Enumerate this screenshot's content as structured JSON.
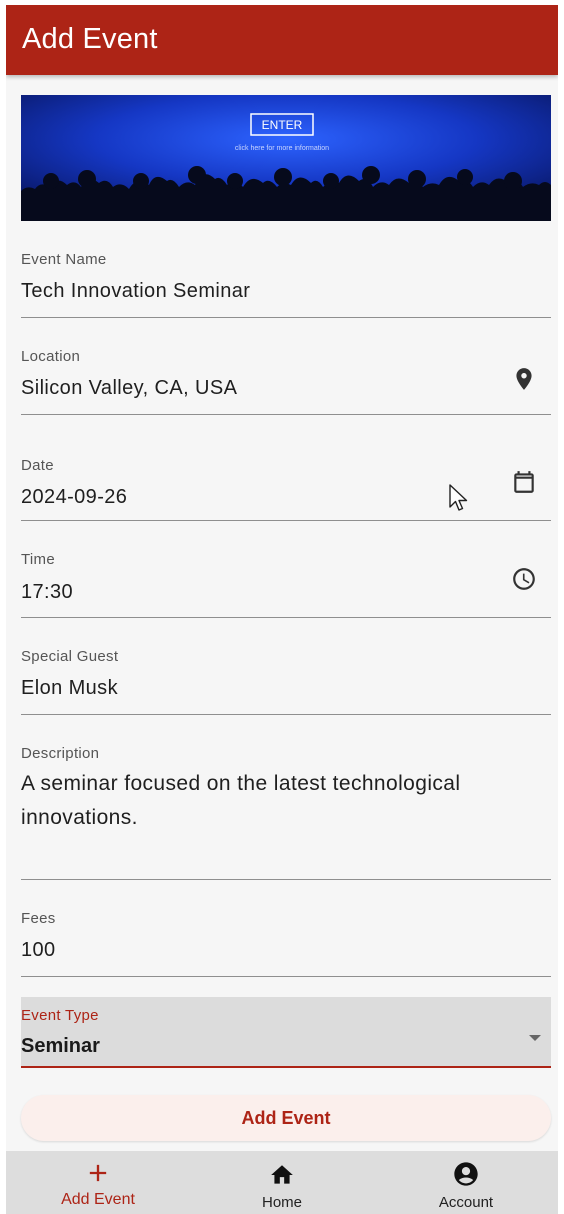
{
  "appbar": {
    "title": "Add Event"
  },
  "banner": {
    "button_label": "ENTER",
    "caption": "click here for more information"
  },
  "form": {
    "event_name": {
      "label": "Event Name",
      "value": "Tech Innovation Seminar"
    },
    "location": {
      "label": "Location",
      "value": "Silicon Valley, CA, USA",
      "icon": "location-pin-icon"
    },
    "date": {
      "label": "Date",
      "value": "2024-09-26",
      "icon": "calendar-icon"
    },
    "time": {
      "label": "Time",
      "value": "17:30",
      "icon": "clock-icon"
    },
    "special_guest": {
      "label": "Special Guest",
      "value": "Elon Musk"
    },
    "description": {
      "label": "Description",
      "value": "A seminar focused on the latest technological innovations."
    },
    "fees": {
      "label": "Fees",
      "value": "100"
    },
    "event_type": {
      "label": "Event Type",
      "value": "Seminar"
    }
  },
  "submit": {
    "label": "Add Event"
  },
  "bottom_nav": {
    "items": [
      {
        "label": "Add Event",
        "icon": "plus-icon",
        "active": true
      },
      {
        "label": "Home",
        "icon": "home-icon",
        "active": false
      },
      {
        "label": "Account",
        "icon": "account-circle-icon",
        "active": false
      }
    ]
  },
  "colors": {
    "primary": "#ad2416",
    "background": "#f6f6f6",
    "nav_background": "#dddddd",
    "button_background": "#fbefec"
  }
}
